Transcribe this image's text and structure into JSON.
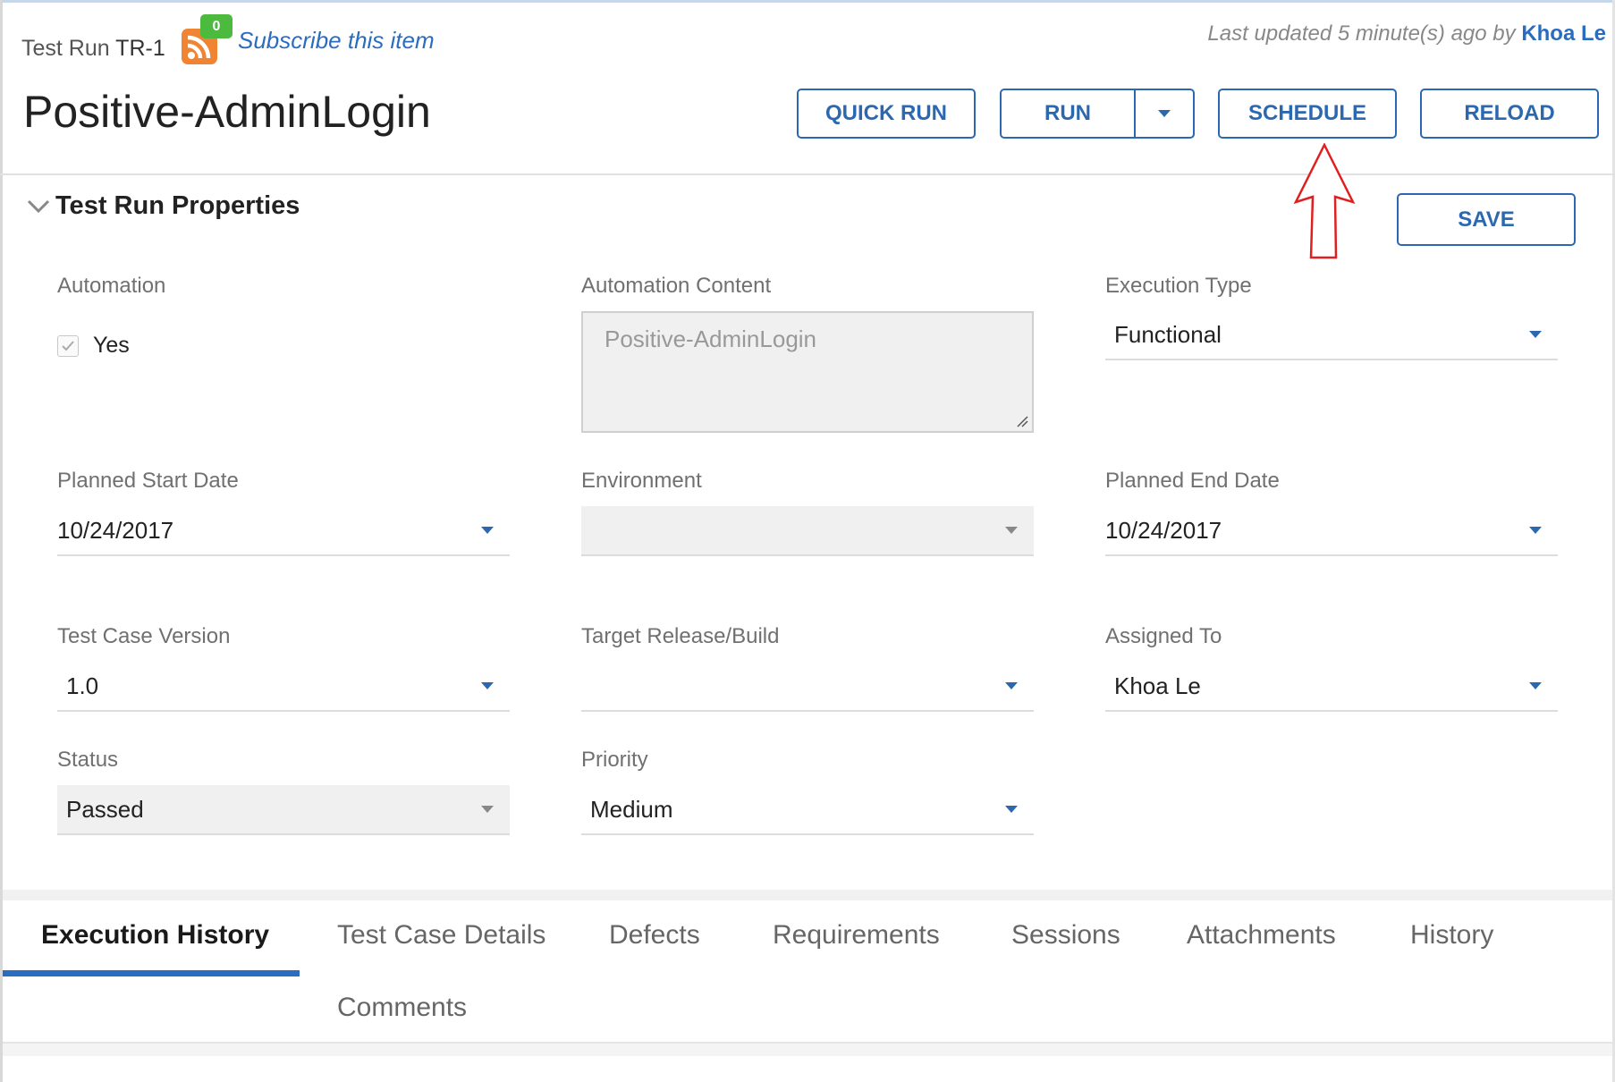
{
  "header": {
    "id_prefix": "Test Run",
    "id_value": "TR-1",
    "subscribe_count": "0",
    "subscribe_label": "Subscribe this item",
    "updated_text": "Last updated 5 minute(s) ago by",
    "updated_by": "Khoa Le",
    "title": "Positive-AdminLogin"
  },
  "toolbar": {
    "quick_run": "QUICK RUN",
    "run": "RUN",
    "schedule": "SCHEDULE",
    "reload": "RELOAD",
    "save": "SAVE"
  },
  "section": {
    "title": "Test Run Properties"
  },
  "fields": {
    "automation": {
      "label": "Automation",
      "checked": true,
      "value": "Yes"
    },
    "automation_content": {
      "label": "Automation Content",
      "value": "Positive-AdminLogin"
    },
    "execution_type": {
      "label": "Execution Type",
      "value": "Functional"
    },
    "planned_start_date": {
      "label": "Planned Start Date",
      "value": "10/24/2017"
    },
    "environment": {
      "label": "Environment",
      "value": ""
    },
    "planned_end_date": {
      "label": "Planned End Date",
      "value": "10/24/2017"
    },
    "test_case_version": {
      "label": "Test Case Version",
      "value": "1.0"
    },
    "target_release": {
      "label": "Target Release/Build",
      "value": ""
    },
    "assigned_to": {
      "label": "Assigned To",
      "value": "Khoa Le"
    },
    "status": {
      "label": "Status",
      "value": "Passed"
    },
    "priority": {
      "label": "Priority",
      "value": "Medium"
    }
  },
  "tabs": [
    {
      "label": "Execution History",
      "active": true
    },
    {
      "label": "Test Case Details",
      "active": false
    },
    {
      "label": "Defects",
      "active": false
    },
    {
      "label": "Requirements",
      "active": false
    },
    {
      "label": "Sessions",
      "active": false
    },
    {
      "label": "Attachments",
      "active": false
    },
    {
      "label": "History",
      "active": false
    },
    {
      "label": "Comments",
      "active": false
    }
  ],
  "colors": {
    "accent": "#2c68b0",
    "link": "#2a6dc0",
    "rss": "#f08432",
    "badge": "#4cb93f",
    "annotation": "#e02020"
  },
  "icons": {
    "rss": "rss-feed-icon",
    "collapse": "chevron-down-icon",
    "dropdown": "caret-down-icon",
    "check": "checkmark-icon",
    "resize": "resize-grip-icon",
    "annotation": "arrow-up-annotation-icon"
  }
}
